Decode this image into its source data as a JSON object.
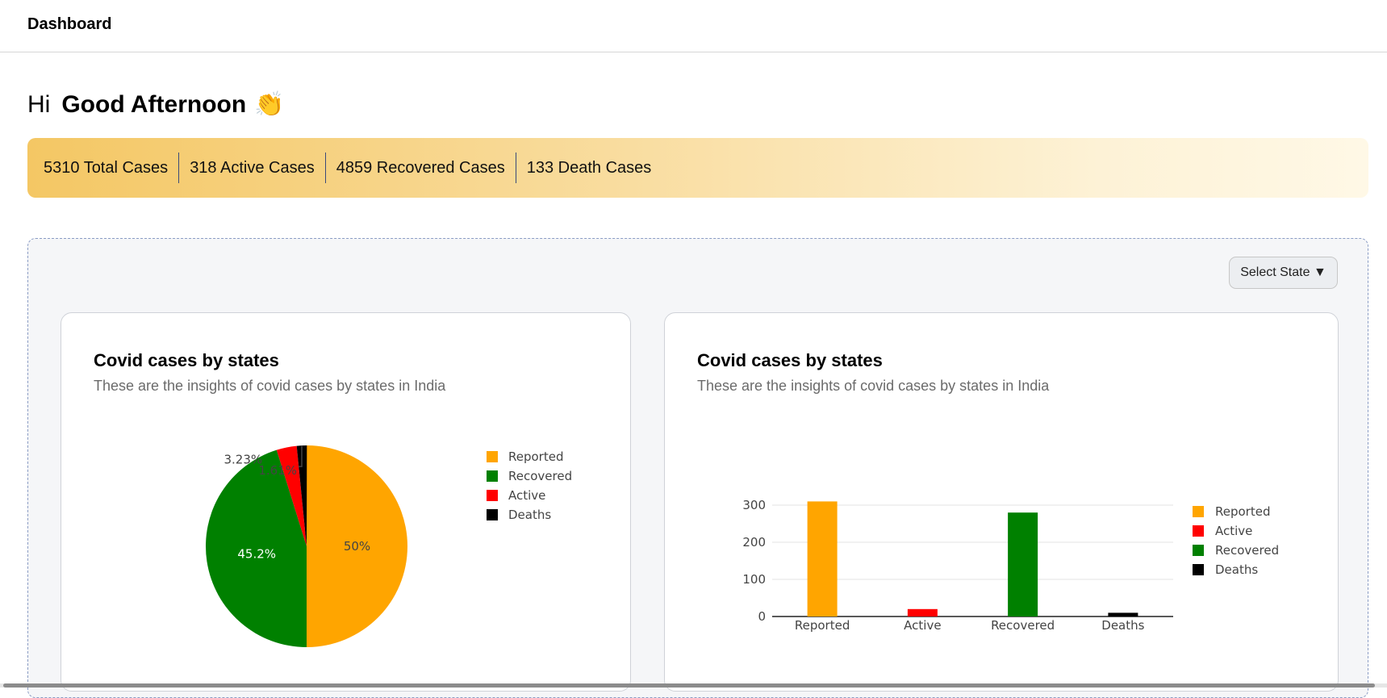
{
  "header": {
    "title": "Dashboard"
  },
  "greeting": {
    "hi": "Hi",
    "message": "Good Afternoon",
    "emoji": "👏"
  },
  "stats": [
    {
      "label": "5310 Total Cases"
    },
    {
      "label": "318 Active Cases"
    },
    {
      "label": "4859 Recovered Cases"
    },
    {
      "label": "133 Death Cases"
    }
  ],
  "select_state": {
    "label": "Select State ▼"
  },
  "cards": [
    {
      "title": "Covid cases by states",
      "subtitle": "These are the insights of covid cases by states in India"
    },
    {
      "title": "Covid cases by states",
      "subtitle": "These are the insights of covid cases by states in India"
    }
  ],
  "colors": {
    "Reported": "#ffa500",
    "Recovered": "#008000",
    "Active": "#ff0000",
    "Deaths": "#000000"
  },
  "chart_data": [
    {
      "type": "pie",
      "legend": [
        "Reported",
        "Recovered",
        "Active",
        "Deaths"
      ],
      "legend_position": "top-right",
      "slices": [
        {
          "name": "Reported",
          "percent": 50,
          "label": "50%"
        },
        {
          "name": "Recovered",
          "percent": 45.2,
          "label": "45.2%"
        },
        {
          "name": "Active",
          "percent": 3.23,
          "label": "3.23%"
        },
        {
          "name": "Deaths",
          "percent": 1.61,
          "label": "1.61%"
        }
      ]
    },
    {
      "type": "bar",
      "categories": [
        "Reported",
        "Active",
        "Recovered",
        "Deaths"
      ],
      "values": [
        310,
        20,
        280,
        10
      ],
      "ylim": [
        0,
        300
      ],
      "yticks": [
        0,
        100,
        200,
        300
      ],
      "grid": true,
      "legend": [
        "Reported",
        "Active",
        "Recovered",
        "Deaths"
      ],
      "legend_position": "right"
    }
  ]
}
